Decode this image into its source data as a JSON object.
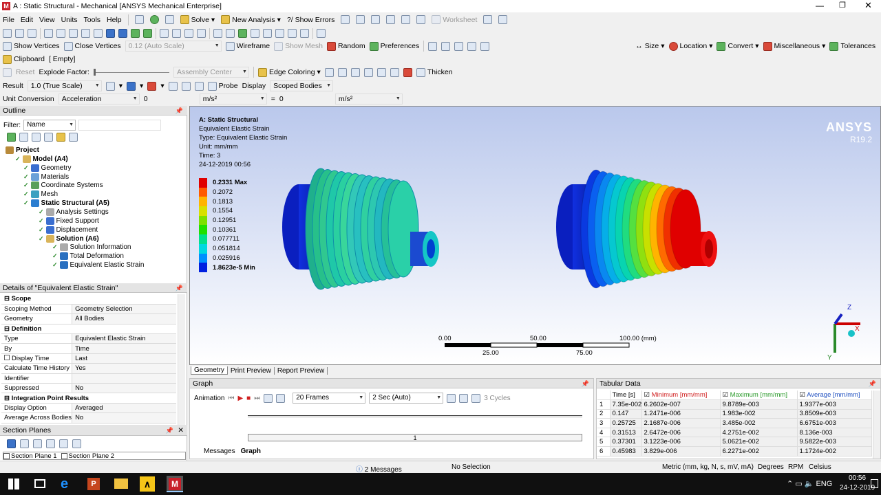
{
  "window": {
    "title": "A : Static Structural - Mechanical [ANSYS Mechanical Enterprise]"
  },
  "menu": [
    "File",
    "Edit",
    "View",
    "Units",
    "Tools",
    "Help"
  ],
  "toolbar1": {
    "solve": "Solve",
    "new_analysis": "New Analysis",
    "show_errors": "?/ Show Errors",
    "worksheet": "Worksheet"
  },
  "toolbar3": {
    "show_vertices": "Show Vertices",
    "close_vertices": "Close Vertices",
    "scale": "0.12 (Auto Scale)",
    "wireframe": "Wireframe",
    "show_mesh": "Show Mesh",
    "random": "Random",
    "preferences": "Preferences",
    "size": "Size",
    "location": "Location",
    "convert": "Convert",
    "miscellaneous": "Miscellaneous",
    "tolerances": "Tolerances"
  },
  "toolbar4": {
    "clipboard": "Clipboard",
    "empty": "[ Empty]"
  },
  "toolbar5": {
    "reset": "Reset",
    "explode_factor": "Explode Factor:",
    "assembly_center": "Assembly Center",
    "edge_coloring": "Edge Coloring",
    "thicken": "Thicken"
  },
  "toolbar6": {
    "result_label": "Result",
    "result_value": "1.0 (True Scale)",
    "probe": "Probe",
    "display_label": "Display",
    "display_value": "Scoped Bodies"
  },
  "toolbar7": {
    "unit_conversion": "Unit Conversion",
    "acceleration": "Acceleration",
    "v1": "0",
    "u1": "m/s²",
    "eq": "=",
    "v2": "0",
    "u2": "m/s²"
  },
  "outline": {
    "title": "Outline",
    "filter_label": "Filter:",
    "filter_value": "Name",
    "tree": [
      {
        "label": "Project",
        "bold": true
      },
      {
        "label": "Model (A4)",
        "bold": true
      },
      {
        "label": "Geometry"
      },
      {
        "label": "Materials"
      },
      {
        "label": "Coordinate Systems"
      },
      {
        "label": "Mesh"
      },
      {
        "label": "Static Structural (A5)",
        "bold": true
      },
      {
        "label": "Analysis Settings"
      },
      {
        "label": "Fixed Support"
      },
      {
        "label": "Displacement"
      },
      {
        "label": "Solution (A6)",
        "bold": true
      },
      {
        "label": "Solution Information"
      },
      {
        "label": "Total Deformation"
      },
      {
        "label": "Equivalent Elastic Strain"
      }
    ]
  },
  "details": {
    "title": "Details of \"Equivalent Elastic Strain\"",
    "rows": [
      {
        "k": "Scope",
        "v": "",
        "section": true
      },
      {
        "k": "Scoping Method",
        "v": "Geometry Selection"
      },
      {
        "k": "Geometry",
        "v": "All Bodies"
      },
      {
        "k": "Definition",
        "v": "",
        "section": true
      },
      {
        "k": "Type",
        "v": "Equivalent Elastic Strain"
      },
      {
        "k": "By",
        "v": "Time"
      },
      {
        "k": "Display Time",
        "v": "Last"
      },
      {
        "k": "Calculate Time History",
        "v": "Yes"
      },
      {
        "k": "Identifier",
        "v": ""
      },
      {
        "k": "Suppressed",
        "v": "No"
      },
      {
        "k": "Integration Point Results",
        "v": "",
        "section": true
      },
      {
        "k": "Display Option",
        "v": "Averaged"
      },
      {
        "k": "Average Across Bodies",
        "v": "No"
      }
    ]
  },
  "section_planes": {
    "title": "Section Planes",
    "items": [
      "Section Plane 1",
      "Section Plane 2"
    ]
  },
  "viewport": {
    "info": [
      "A: Static Structural",
      "Equivalent Elastic Strain",
      "Type: Equivalent Elastic Strain",
      "Unit: mm/mm",
      "Time: 3",
      "24-12-2019 00:56"
    ],
    "brand": "ANSYS",
    "version": "R19.2",
    "legend": [
      {
        "label": "0.2331 Max",
        "color": "#e00000"
      },
      {
        "label": "0.2072",
        "color": "#ff5a00"
      },
      {
        "label": "0.1813",
        "color": "#ffb400"
      },
      {
        "label": "0.1554",
        "color": "#d8e000"
      },
      {
        "label": "0.12951",
        "color": "#7de000"
      },
      {
        "label": "0.10361",
        "color": "#20e000"
      },
      {
        "label": "0.077711",
        "color": "#00e08c"
      },
      {
        "label": "0.051814",
        "color": "#00d8e0"
      },
      {
        "label": "0.025916",
        "color": "#0090ff"
      },
      {
        "label": "1.8623e-5 Min",
        "color": "#0020e0"
      }
    ],
    "scale_top": [
      "0.00",
      "50.00",
      "100.00 (mm)"
    ],
    "scale_bottom": [
      "25.00",
      "75.00"
    ],
    "axes": {
      "z": "Z",
      "x": "X",
      "y": "Y"
    },
    "tabs": [
      "Geometry",
      "Print Preview",
      "Report Preview"
    ]
  },
  "graph": {
    "title": "Graph",
    "animation": "Animation",
    "frames": "20 Frames",
    "duration": "2 Sec (Auto)",
    "cycles": "3 Cycles",
    "counter": "1",
    "tabs": [
      "Messages",
      "Graph"
    ]
  },
  "tabular": {
    "title": "Tabular Data",
    "headers": [
      "Time [s]",
      "Minimum [mm/mm]",
      "Maximum [mm/mm]",
      "Average [mm/mm]"
    ],
    "rows": [
      [
        "1",
        "7.35e-002",
        "6.2602e-007",
        "9.8789e-003",
        "1.9377e-003"
      ],
      [
        "2",
        "0.147",
        "1.2471e-006",
        "1.983e-002",
        "3.8509e-003"
      ],
      [
        "3",
        "0.25725",
        "2.1687e-006",
        "3.485e-002",
        "6.6751e-003"
      ],
      [
        "4",
        "0.31513",
        "2.6472e-006",
        "4.2751e-002",
        "8.136e-003"
      ],
      [
        "5",
        "0.37301",
        "3.1223e-006",
        "5.0621e-002",
        "9.5822e-003"
      ],
      [
        "6",
        "0.45983",
        "3.829e-006",
        "6.2271e-002",
        "1.1724e-002"
      ]
    ]
  },
  "status": {
    "messages": "2 Messages",
    "selection": "No Selection",
    "units": "Metric (mm, kg, N, s, mV, mA)",
    "degrees": "Degrees",
    "rpm": "RPM",
    "celsius": "Celsius"
  },
  "taskbar": {
    "time": "00:56",
    "date": "24-12-2019"
  }
}
